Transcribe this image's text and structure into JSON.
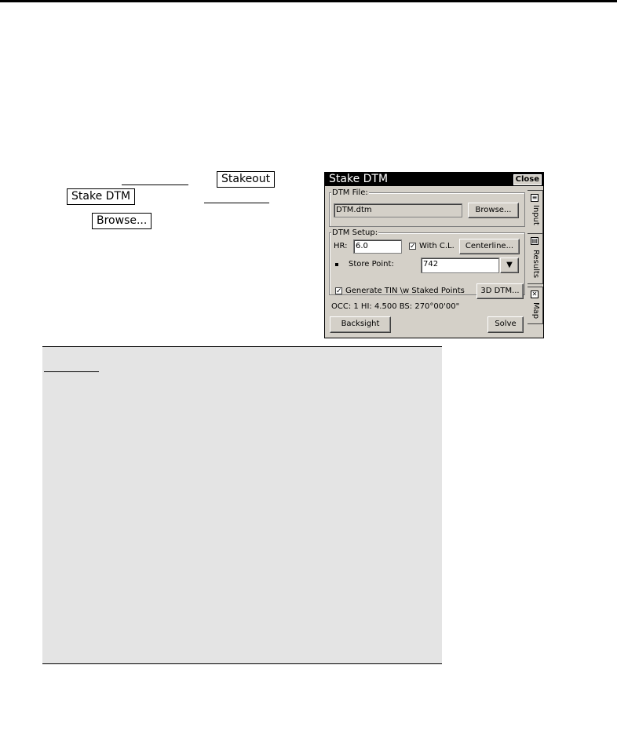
{
  "doc": {
    "stakeout_key": "Stakeout",
    "stake_dtm_key": "Stake DTM",
    "browse_key": "Browse..."
  },
  "dialog": {
    "title": "Stake DTM",
    "close_label": "Close",
    "dtm_file_group": "DTM File:",
    "dtm_file_value": "DTM.dtm",
    "browse_label": "Browse...",
    "setup_group": "DTM Setup:",
    "hr_label": "HR:",
    "hr_value": "6.0",
    "with_cl_label": "With C.L.",
    "with_cl_checked": "✓",
    "centerline_label": "Centerline...",
    "store_point_label": "Store Point:",
    "store_point_value": "742",
    "generate_tin_label": "Generate TIN \\w Staked Points",
    "generate_tin_checked": "✓",
    "dtm3d_label": "3D DTM...",
    "status_line": "OCC: 1  HI: 4.500  BS: 270°00'00\"",
    "backsight_label": "Backsight",
    "solve_label": "Solve",
    "tabs": [
      {
        "label": "Input",
        "icon": "input-icon"
      },
      {
        "label": "Results",
        "icon": "results-icon"
      },
      {
        "label": "Map",
        "icon": "map-icon"
      }
    ]
  }
}
